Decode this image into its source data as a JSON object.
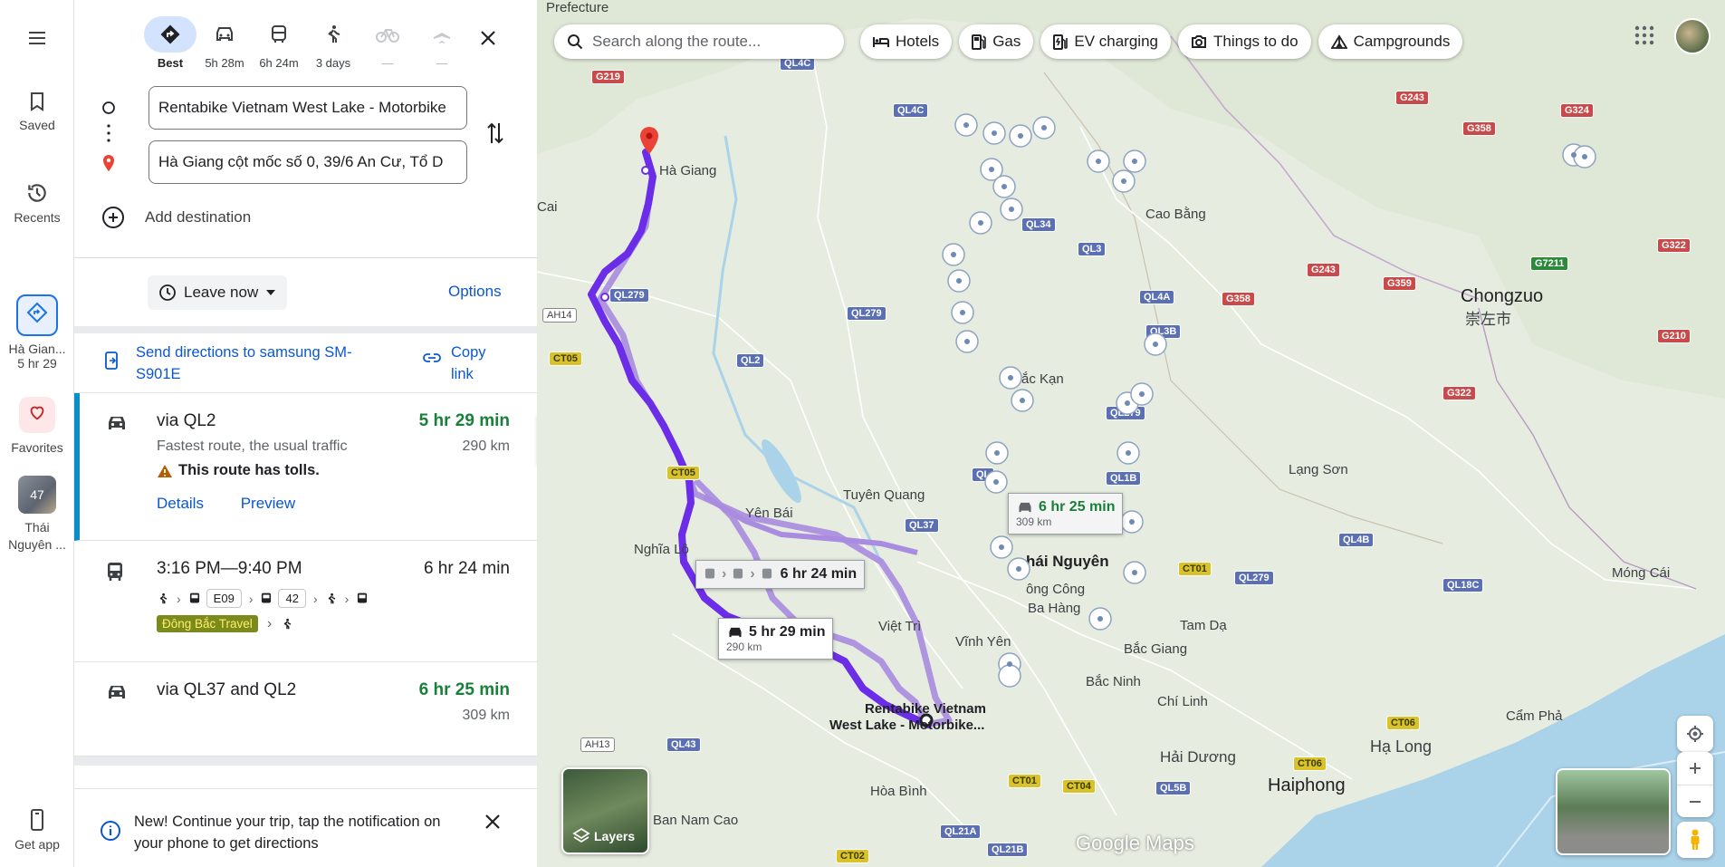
{
  "rail": {
    "saved_label": "Saved",
    "recents_label": "Recents",
    "recent_trip_label": "Hà Gian...",
    "recent_trip_time": "5 hr 29",
    "favorites_label": "Favorites",
    "place_count": "47",
    "place_label": "Thái Nguyên ...",
    "get_app_label": "Get app"
  },
  "modes": [
    {
      "label": "Best",
      "icon": "best-route-icon",
      "active": true
    },
    {
      "label": "5h 28m",
      "icon": "car-icon"
    },
    {
      "label": "6h 24m",
      "icon": "transit-icon"
    },
    {
      "label": "3 days",
      "icon": "walk-icon"
    },
    {
      "label": "—",
      "icon": "bike-icon",
      "disabled": true
    },
    {
      "label": "—",
      "icon": "flight-icon",
      "disabled": true
    }
  ],
  "waypoints": {
    "origin": "Rentabike Vietnam West Lake - Motorbike",
    "destination": "Hà Giang cột mốc số 0, 39/6 An Cư, Tổ D",
    "add_destination": "Add destination"
  },
  "leave_now": "Leave now",
  "options_label": "Options",
  "send": {
    "label": "Send directions to samsung SM-S901E",
    "copy_label": "Copy link"
  },
  "routes": [
    {
      "title": "via QL2",
      "time": "5 hr 29 min",
      "distance": "290 km",
      "subtitle": "Fastest route, the usual traffic",
      "warning": "This route has tolls.",
      "details_label": "Details",
      "preview_label": "Preview"
    },
    {
      "title": "3:16 PM—9:40 PM",
      "time": "6 hr 24 min",
      "bus_1": "E09",
      "bus_2": "42",
      "operator": "Đông Bắc Travel"
    },
    {
      "title": "via QL37 and QL2",
      "time": "6 hr 25 min",
      "distance": "309 km"
    }
  ],
  "notice": {
    "text": "New! Continue your trip, tap the notification on your phone to get directions"
  },
  "map": {
    "search_placeholder": "Search along the route...",
    "chips": [
      "Hotels",
      "Gas",
      "EV charging",
      "Things to do",
      "Campgrounds"
    ],
    "callout_alt_time": "6 hr 25 min",
    "callout_alt_dist": "309 km",
    "callout_transit_time": "6 hr 24 min",
    "callout_main_time": "5 hr 29 min",
    "callout_main_dist": "290 km",
    "origin_label_1": "Rentabike Vietnam",
    "origin_label_2": "West Lake - Motorbike...",
    "places": {
      "ha_giang": "Hà Giang",
      "cao_bang": "Cao Bằng",
      "chongzuo": "Chongzuo",
      "chongzuo_cn": "崇左市",
      "bac_kan": "ắc Kạn",
      "tuyen_quang": "Tuyên Quang",
      "yen_bai": "Yên Bái",
      "nghia_lo": "Nghĩa Lộ",
      "lang_son": "Lạng Sơn",
      "thai_nguyen": "hái Nguyên",
      "song_cong": "ông Công",
      "ba_hang": "Ba Hàng",
      "viet_tri": "Việt Trì",
      "vinh_yen": "Vĩnh Yên",
      "tam_dao": "Tam Dạ",
      "bac_giang": "Bắc Giang",
      "bac_ninh": "Bắc Ninh",
      "chi_linh": "Chí Linh",
      "mong_cai": "Móng Cái",
      "cam_pha": "Cẩm Phả",
      "hai_duong": "Hải Dương",
      "ha_long": "Hạ Long",
      "haiphong": "Haiphong",
      "hoa_binh": "Hòa Bình",
      "ban_nam_cao": "Ban Nam Cao",
      "prefecture": "Prefecture",
      "cai": "Cai",
      "ang": "ang"
    },
    "roads": {
      "g219": "G219",
      "ql4c_a": "QL4C",
      "ql4c_b": "QL4C",
      "ql34": "QL34",
      "ql3": "QL3",
      "ql4a": "QL4A",
      "ql3b": "QL3B",
      "ql279_a": "QL279",
      "ql279_b": "QL279",
      "ql279_c": "QL279",
      "ql279_d": "QL279",
      "ql2": "QL2",
      "ql37": "QL37",
      "ql1b": "QL1B",
      "ql4b": "QL4B",
      "ql18c": "QL18C",
      "ql43": "QL43",
      "ql5b": "QL5B",
      "ql21a": "QL21A",
      "ql21b": "QL21B",
      "ct05_a": "CT05",
      "ct05_b": "CT05",
      "ct01_a": "CT01",
      "ct01_b": "CT01",
      "ct04": "CT04",
      "ct06_a": "CT06",
      "ct06_b": "CT06",
      "ct02": "CT02",
      "ah14": "AH14",
      "ah13": "AH13",
      "g243_a": "G243",
      "g243_b": "G243",
      "g324": "G324",
      "g358_a": "G358",
      "g358_b": "G358",
      "g359": "G359",
      "g322_a": "G322",
      "g322_b": "G322",
      "g210": "G210",
      "g7211": "G7211",
      "ql": "QL"
    },
    "layers_label": "Layers",
    "logo": "Google Maps"
  }
}
